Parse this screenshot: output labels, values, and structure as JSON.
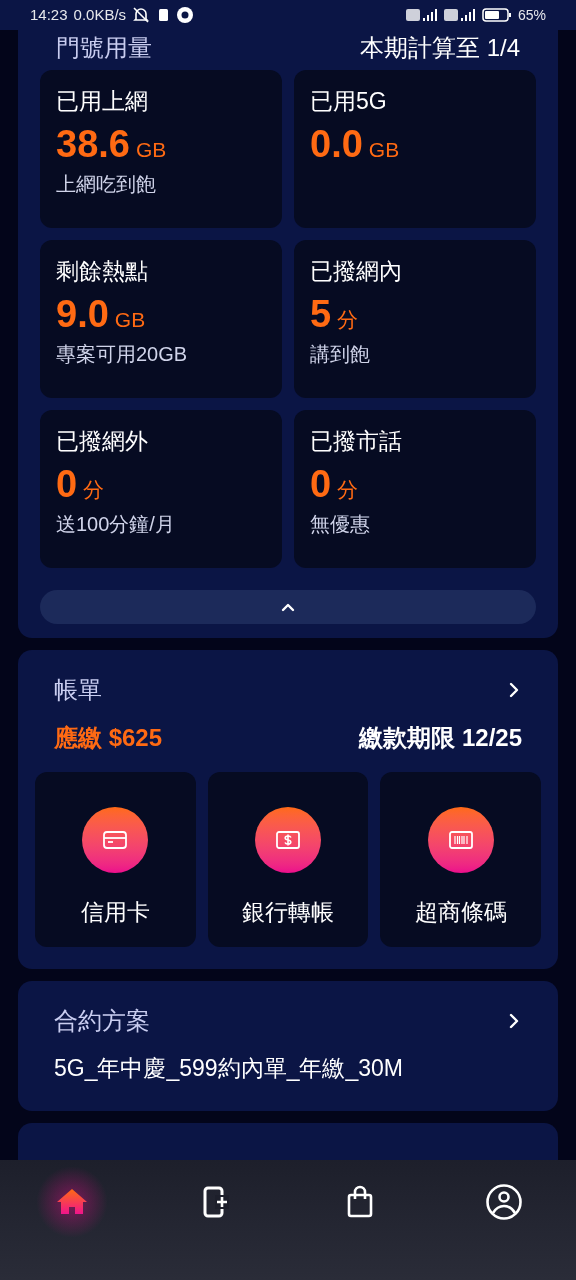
{
  "status_bar": {
    "time": "14:23",
    "speed": "0.0KB/s",
    "battery": "65%"
  },
  "usage": {
    "title": "門號用量",
    "period": "本期計算至 1/4",
    "expanded": true,
    "stats": [
      {
        "label": "已用上網",
        "value": "38.6",
        "unit": "GB",
        "note": "上網吃到飽"
      },
      {
        "label": "已用5G",
        "value": "0.0",
        "unit": "GB"
      },
      {
        "label": "剩餘熱點",
        "value": "9.0",
        "unit": "GB",
        "note": "專案可用20GB"
      },
      {
        "label": "已撥網內",
        "value": "5",
        "unit": "分",
        "note": "講到飽"
      },
      {
        "label": "已撥網外",
        "value": "0",
        "unit": "分",
        "note": "送100分鐘/月"
      },
      {
        "label": "已撥市話",
        "value": "0",
        "unit": "分",
        "note": "無優惠"
      }
    ]
  },
  "bill": {
    "title": "帳單",
    "amount": "應繳 $625",
    "due": "繳款期限 12/25",
    "methods": [
      {
        "kind": "card",
        "label": "信用卡"
      },
      {
        "kind": "bank",
        "label": "銀行轉帳"
      },
      {
        "kind": "barcode",
        "label": "超商條碼"
      }
    ]
  },
  "contract": {
    "title": "合約方案",
    "plan": "5G_年中慶_599約內單_年繳_30M"
  },
  "nav": [
    {
      "kind": "home",
      "selected": true
    },
    {
      "kind": "add-phone",
      "selected": false
    },
    {
      "kind": "shop",
      "selected": false
    },
    {
      "kind": "account",
      "selected": false
    }
  ]
}
